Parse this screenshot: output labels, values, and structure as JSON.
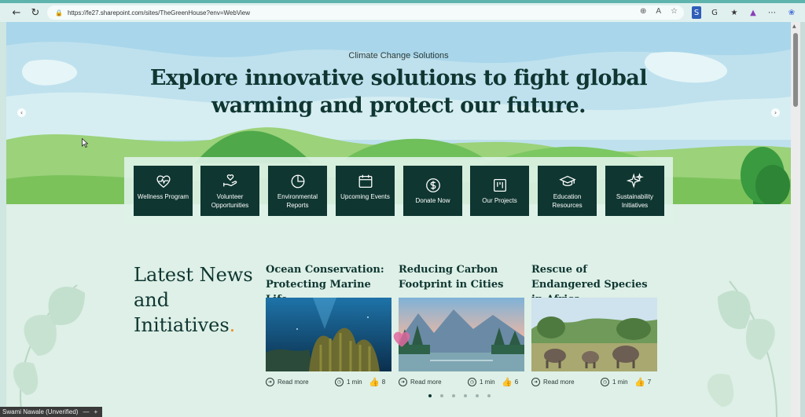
{
  "browser": {
    "url": "https://fe27.sharepoint.com/sites/TheGreenHouse?env=WebView",
    "extensions": [
      "S",
      "G"
    ]
  },
  "hero": {
    "kicker": "Climate Change Solutions",
    "headline": "Explore innovative solutions to fight global warming and protect our future."
  },
  "quick_links": [
    {
      "label": "Wellness Program",
      "icon": "heart-pulse-icon"
    },
    {
      "label": "Volunteer Opportunities",
      "icon": "helping-hand-icon"
    },
    {
      "label": "Environmental Reports",
      "icon": "pie-chart-icon"
    },
    {
      "label": "Upcoming Events",
      "icon": "calendar-icon"
    },
    {
      "label": "Donate Now",
      "icon": "dollar-icon"
    },
    {
      "label": "Our Projects",
      "icon": "kanban-icon"
    },
    {
      "label": "Education Resources",
      "icon": "graduation-cap-icon"
    },
    {
      "label": "Sustainability Initiatives",
      "icon": "sparkles-icon"
    }
  ],
  "news": {
    "title": "Latest News and Initiatives",
    "title_dot": ".",
    "read_more": "Read more",
    "cards": [
      {
        "title": "Ocean Conservation: Protecting Marine Life",
        "time": "1 min",
        "likes": "8"
      },
      {
        "title": "Reducing Carbon Footprint in Cities",
        "time": "1 min",
        "likes": "6"
      },
      {
        "title": "Rescue of Endangered Species in Africa",
        "time": "1 min",
        "likes": "7"
      }
    ],
    "pages": 6,
    "active_page": 1
  },
  "status": {
    "user": "Swami Nawale (Unverified)",
    "min": "—",
    "plus": "+"
  },
  "colors": {
    "brand_dark": "#0f3631",
    "accent_dot": "#f28c1e",
    "page_bg": "#def0e7"
  }
}
